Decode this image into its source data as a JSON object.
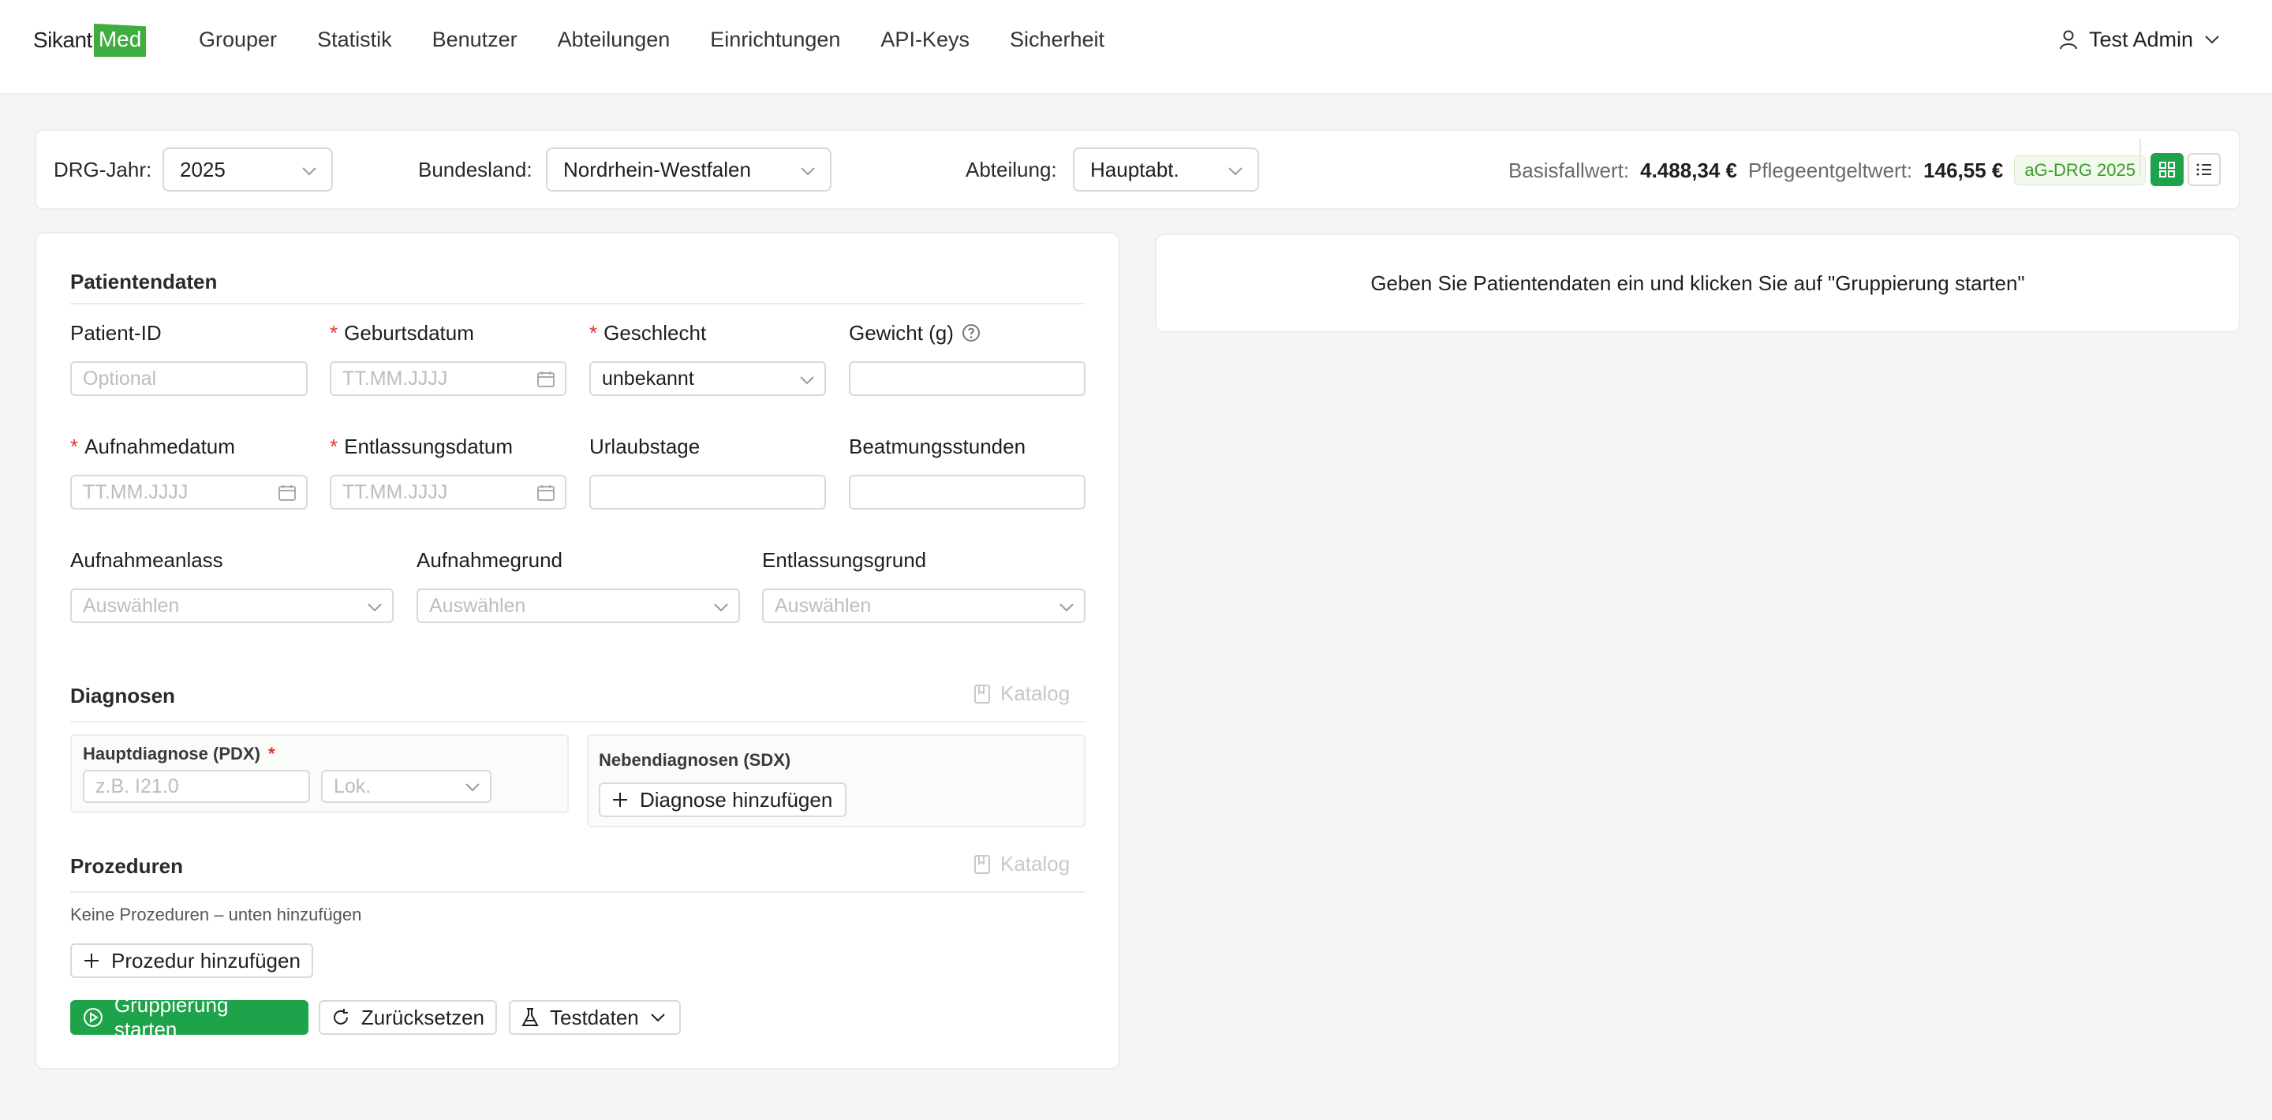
{
  "header": {
    "logo": {
      "part1": "Sikant",
      "part2": "Med"
    },
    "nav": [
      "Grouper",
      "Statistik",
      "Benutzer",
      "Abteilungen",
      "Einrichtungen",
      "API-Keys",
      "Sicherheit"
    ],
    "user_name": "Test Admin"
  },
  "filters": {
    "drg_year_label": "DRG-Jahr:",
    "drg_year_value": "2025",
    "state_label": "Bundesland:",
    "state_value": "Nordrhein-Westfalen",
    "dept_label": "Abteilung:",
    "dept_value": "Hauptabt.",
    "base_label": "Basisfallwert:",
    "base_value": "4.488,34 €",
    "care_label": "Pflegeentgeltwert:",
    "care_value": "146,55 €",
    "badge": "aG-DRG 2025"
  },
  "patient": {
    "title": "Patientendaten",
    "patient_id_label": "Patient-ID",
    "patient_id_placeholder": "Optional",
    "birth_label": "Geburtsdatum",
    "birth_placeholder": "TT.MM.JJJJ",
    "sex_label": "Geschlecht",
    "sex_value": "unbekannt",
    "weight_label": "Gewicht (g)",
    "admission_label": "Aufnahmedatum",
    "admission_placeholder": "TT.MM.JJJJ",
    "discharge_label": "Entlassungsdatum",
    "discharge_placeholder": "TT.MM.JJJJ",
    "leave_label": "Urlaubstage",
    "ventilation_label": "Beatmungsstunden",
    "adm_occasion_label": "Aufnahmeanlass",
    "adm_occasion_placeholder": "Auswählen",
    "adm_reason_label": "Aufnahmegrund",
    "adm_reason_placeholder": "Auswählen",
    "dis_reason_label": "Entlassungsgrund",
    "dis_reason_placeholder": "Auswählen"
  },
  "diagnoses": {
    "title": "Diagnosen",
    "catalog": "Katalog",
    "pdx_label": "Hauptdiagnose (PDX)",
    "pdx_placeholder": "z.B. I21.0",
    "loc_placeholder": "Lok.",
    "sdx_label": "Nebendiagnosen (SDX)",
    "add_label": "Diagnose hinzufügen"
  },
  "procedures": {
    "title": "Prozeduren",
    "catalog": "Katalog",
    "empty_hint": "Keine Prozeduren – unten hinzufügen",
    "add_label": "Prozedur hinzufügen"
  },
  "actions": {
    "start": "Gruppierung starten",
    "reset": "Zurücksetzen",
    "testdata": "Testdaten"
  },
  "result": {
    "message": "Geben Sie Patientendaten ein und klicken Sie auf \"Gruppierung starten\""
  },
  "colors": {
    "brand_green": "#3fae3f",
    "primary_button": "#1fa34a",
    "required": "#e0342c",
    "badge_text": "#3c9a2a"
  }
}
